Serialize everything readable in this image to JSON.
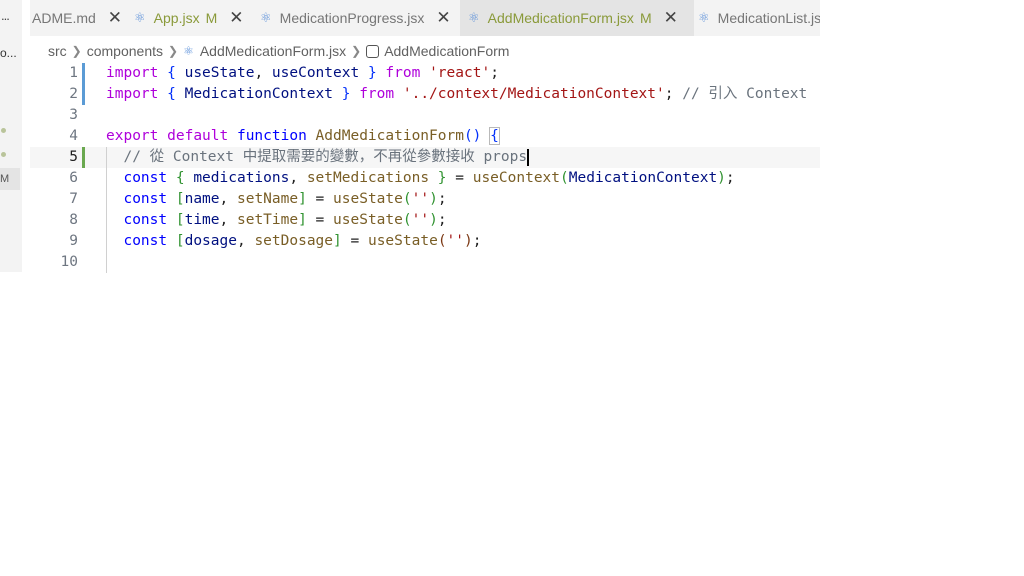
{
  "activity": {
    "more_label": "...",
    "explorer_label": "o...",
    "status_m": "M"
  },
  "tabs": [
    {
      "label": "ADME.md",
      "modified": "",
      "active": false
    },
    {
      "label": "App.jsx",
      "modified": "M",
      "active": false
    },
    {
      "label": "MedicationProgress.jsx",
      "modified": "",
      "active": false
    },
    {
      "label": "AddMedicationForm.jsx",
      "modified": "M",
      "active": true
    },
    {
      "label": "MedicationList.js",
      "modified": "",
      "active": false
    }
  ],
  "breadcrumb": {
    "parts": [
      "src",
      "components",
      "AddMedicationForm.jsx",
      "AddMedicationForm"
    ]
  },
  "editor": {
    "current_line": 5,
    "lines": [
      {
        "n": "1",
        "text": "import { useState, useContext } from 'react';"
      },
      {
        "n": "2",
        "text": "import { MedicationContext } from '../context/MedicationContext'; // 引入 Context"
      },
      {
        "n": "3",
        "text": ""
      },
      {
        "n": "4",
        "text": "export default function AddMedicationForm() {"
      },
      {
        "n": "5",
        "text": "  // 從 Context 中提取需要的變數，不再從參數接收 props"
      },
      {
        "n": "6",
        "text": "  const { medications, setMedications } = useContext(MedicationContext);"
      },
      {
        "n": "7",
        "text": "  const [name, setName] = useState('');"
      },
      {
        "n": "8",
        "text": "  const [time, setTime] = useState('');"
      },
      {
        "n": "9",
        "text": "  const [dosage, setDosage] = useState('');"
      },
      {
        "n": "10",
        "text": ""
      }
    ]
  }
}
